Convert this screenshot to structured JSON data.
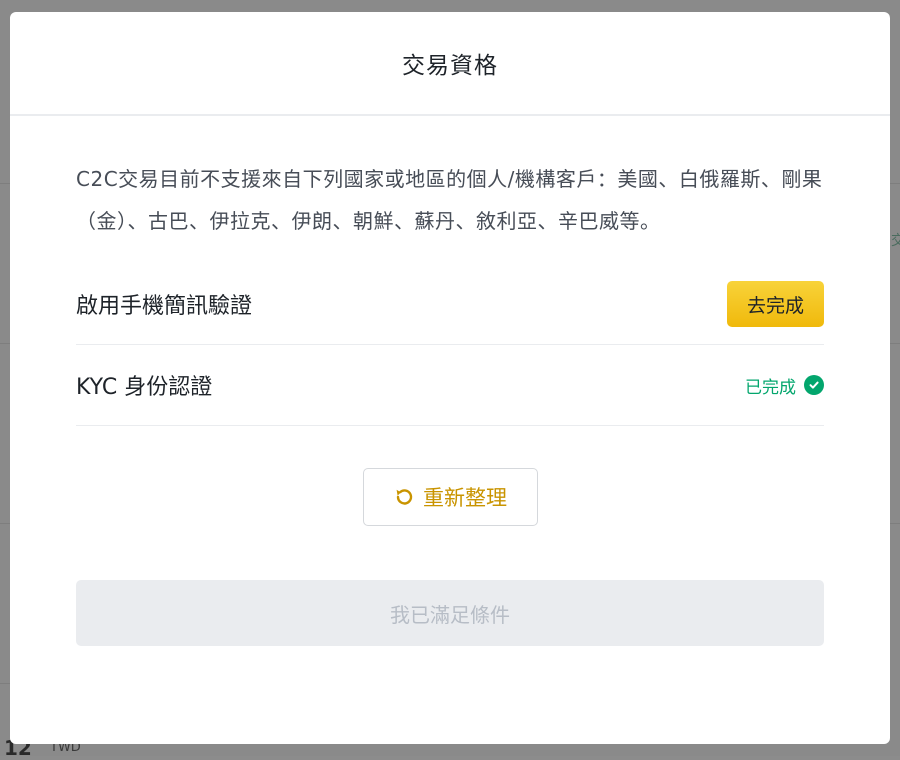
{
  "modal": {
    "title": "交易資格",
    "notice": "C2C交易目前不支援來自下列國家或地區的個人/機構客戶：美國、白俄羅斯、剛果（金）、古巴、伊拉克、伊朗、朝鮮、蘇丹、敘利亞、辛巴威等。",
    "requirements": [
      {
        "label": "啟用手機簡訊驗證",
        "action_label": "去完成"
      },
      {
        "label": "KYC 身份認證",
        "status_label": "已完成",
        "status_icon": "check-circle-icon"
      }
    ],
    "refresh_label": "重新整理",
    "refresh_icon": "refresh-icon",
    "submit_label": "我已滿足條件"
  },
  "background": {
    "bottom_text": "12",
    "bottom_unit": "TWD",
    "edge_char": "交"
  },
  "colors": {
    "accent": "#f0b90b",
    "accent_text": "#c99400",
    "success": "#03a66d",
    "disabled_bg": "#eaecef",
    "disabled_text": "#b7bdc6",
    "overlay": "#8c8c8c"
  }
}
